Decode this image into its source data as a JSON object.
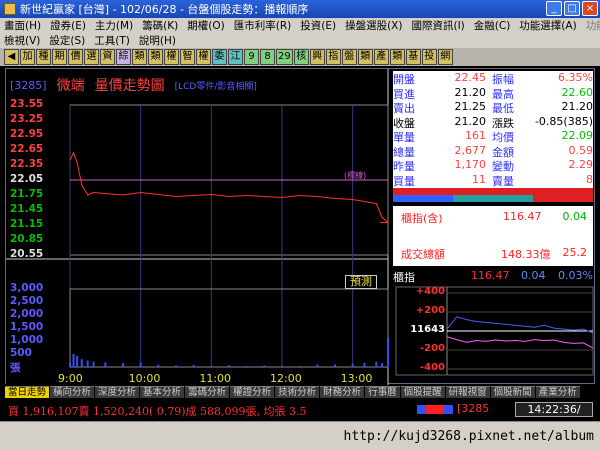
{
  "window": {
    "title": "新世紀贏家 [台灣] - 102/06/28 - 台盤個股走勢：播報順序"
  },
  "menu": {
    "row1": [
      "畫面(H)",
      "證券(E)",
      "主力(M)",
      "籌碼(K)",
      "期權(O)",
      "匯市利率(R)",
      "投資(E)",
      "操盤選股(X)",
      "國際資訊(I)",
      "金融(C)",
      "功能選擇(A)",
      "功能操作"
    ],
    "row2": [
      "檢視(V)",
      "設定(S)",
      "工具(T)",
      "說明(H)"
    ]
  },
  "toolbar": {
    "buttons": [
      "◀",
      "加",
      "種",
      "期",
      "價",
      "選",
      "資",
      "綜",
      "類",
      "類",
      "權",
      "智",
      "權",
      "委",
      "江",
      "9",
      "8",
      "29",
      "核",
      "興",
      "指",
      "盤",
      "類",
      "產",
      "類",
      "基",
      "投",
      "網"
    ],
    "colors": [
      "#d4c060",
      "#d4c060",
      "#d4c060",
      "#d4c060",
      "#d4c060",
      "#d4c060",
      "#d4c060",
      "#c8b0e0",
      "#d4c060",
      "#d4c060",
      "#d4c060",
      "#d4c060",
      "#d4c060",
      "#60c0c0",
      "#60c0c0",
      "#80d080",
      "#80d080",
      "#80d080",
      "#80d080",
      "#d4c060",
      "#d4c060",
      "#d4c060",
      "#d4c060",
      "#d4c060",
      "#d4c060",
      "#d4c060",
      "#d4c060",
      "#d4c060"
    ]
  },
  "header": {
    "code": "[3285]",
    "stock_name": "微端",
    "chart_title": "量價走勢圖",
    "sector": "[LCD零件/影音相關]"
  },
  "quote": {
    "rows": [
      {
        "l1": "開盤",
        "v1": "22.45",
        "c1": "#ff4040",
        "l2": "振幅",
        "v2": "6.35%",
        "c2": "#ff4040"
      },
      {
        "l1": "買進",
        "v1": "21.20",
        "c1": "#000000",
        "l2": "最高",
        "v2": "22.60",
        "c2": "#00c000"
      },
      {
        "l1": "賣出",
        "v1": "21.25",
        "c1": "#000000",
        "l2": "最低",
        "v2": "21.20",
        "c2": "#000000"
      },
      {
        "l1": "收盤",
        "v1": "21.20",
        "c1": "#000000",
        "l2": "漲跌",
        "v2": "-0.85(385)",
        "c2": "#000000"
      },
      {
        "l1": "單量",
        "v1": "161",
        "c1": "#ff4040",
        "l2": "均價",
        "v2": "22.09",
        "c2": "#00c000"
      },
      {
        "l1": "總量",
        "v1": "2,677",
        "c1": "#ff4040",
        "l2": "金額",
        "v2": "0.59",
        "c2": "#ff4040"
      },
      {
        "l1": "昨量",
        "v1": "1,170",
        "c1": "#ff4040",
        "l2": "變動",
        "v2": "2.29",
        "c2": "#ff4040"
      },
      {
        "l1": "買量",
        "v1": "11",
        "c1": "#ff4040",
        "l2": "賣量",
        "v2": "8",
        "c2": "#ff4040"
      }
    ],
    "label_colors": [
      "#3030ff",
      "#3030ff",
      "#3030ff",
      "#000000",
      "#3030ff",
      "#3030ff",
      "#3030ff",
      "#3030ff"
    ]
  },
  "index_box": {
    "label1": "櫃指(含)",
    "value1": "116.47",
    "change1": "0.04",
    "label2": "成交總額",
    "value2": "148.33億",
    "change2": "25.2"
  },
  "index_chart": {
    "label": "櫃指",
    "value": "116.47",
    "change": "0.04",
    "pct": "0.03%",
    "y_labels": [
      "+400",
      "+200",
      "11643",
      "-200",
      "-400"
    ]
  },
  "main_chart": {
    "price_ticks": [
      "23.55",
      "23.25",
      "22.95",
      "22.65",
      "22.35",
      "22.05",
      "21.75",
      "21.45",
      "21.15",
      "20.85",
      "20.55"
    ],
    "price_tick_colors": [
      "#ff4040",
      "#ff4040",
      "#ff4040",
      "#ff4040",
      "#ff4040",
      "#e0e0e0",
      "#00c000",
      "#00c000",
      "#00c000",
      "#00c000",
      "#e0e0e0"
    ],
    "vol_ticks": [
      "3,000",
      "2,500",
      "2,000",
      "1,500",
      "1,000",
      "500",
      "張"
    ],
    "time_labels": [
      "9:00",
      "10:00",
      "11:00",
      "12:00",
      "13:00"
    ],
    "ref_label": "(標線)",
    "forecast_button": "預測"
  },
  "chart_data": {
    "type": "line",
    "x": [
      "09:00",
      "09:03",
      "09:06",
      "09:10",
      "09:15",
      "09:20",
      "09:30",
      "09:45",
      "10:00",
      "10:15",
      "10:30",
      "10:45",
      "11:00",
      "11:15",
      "11:30",
      "11:45",
      "12:00",
      "12:15",
      "12:30",
      "12:45",
      "13:00",
      "13:10",
      "13:20",
      "13:25",
      "13:30"
    ],
    "series": [
      {
        "name": "",
        "values": [
          22.45,
          22.6,
          22.4,
          21.95,
          21.75,
          21.8,
          21.78,
          21.75,
          21.8,
          21.76,
          21.72,
          21.74,
          21.76,
          21.72,
          21.74,
          21.72,
          21.7,
          21.74,
          21.72,
          21.68,
          21.66,
          21.62,
          21.58,
          21.3,
          21.2
        ]
      }
    ],
    "reference_price": 22.05,
    "ylim": [
      20.55,
      23.55
    ],
    "volume": [
      160,
      500,
      420,
      300,
      250,
      200,
      180,
      150,
      170,
      90,
      60,
      80,
      50,
      70,
      40,
      60,
      50,
      40,
      90,
      100,
      120,
      160,
      200,
      150,
      1100
    ],
    "volume_ylim": [
      0,
      3000
    ],
    "index": {
      "y_range": [
        -400,
        400
      ],
      "series": [
        {
          "name": "",
          "color": "#4060ff",
          "values": [
            20,
            150,
            120,
            100,
            90,
            80,
            70,
            60,
            50,
            40,
            60,
            30,
            20,
            10,
            20,
            -20
          ]
        },
        {
          "name": "",
          "color": "#ff60ff",
          "values": [
            -60,
            -90,
            -120,
            -100,
            -110,
            -95,
            -105,
            -100,
            -110,
            -90,
            -100,
            -95,
            -120,
            -130,
            -125,
            -180
          ]
        }
      ]
    }
  },
  "tabs": [
    "當日走勢",
    "橫向分析",
    "深度分析",
    "基本分析",
    "籌碼分析",
    "權證分析",
    "技術分析",
    "財務分析",
    "行事曆",
    "個股提醒",
    "研報視窗",
    "個股新聞",
    "產業分析"
  ],
  "status": {
    "text": "買 1,916,107賣 1,520,240( 0.79)成 588,099張, 均張 3.5",
    "code": "[3285",
    "time": "14:22:36/"
  },
  "footer": {
    "url": "http://kujd3268.pixnet.net/album"
  }
}
